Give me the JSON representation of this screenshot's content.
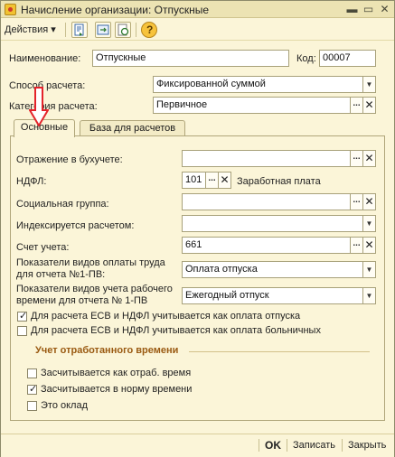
{
  "window": {
    "title": "Начисление организации: Отпускные"
  },
  "toolbar": {
    "actions_label": "Действия",
    "actions_arrow": "▾",
    "help_glyph": "?"
  },
  "form": {
    "name": {
      "label": "Наименование:",
      "value": "Отпускные"
    },
    "code": {
      "label": "Код:",
      "value": "00007"
    },
    "method": {
      "label": "Способ расчета:",
      "value": "Фиксированной суммой"
    },
    "category": {
      "label": "Категория расчета:",
      "value": "Первичное"
    }
  },
  "tabs": [
    {
      "label": "Основные"
    },
    {
      "label": "База для расчетов"
    }
  ],
  "main_tab": {
    "accounting": {
      "label": "Отражение в бухучете:",
      "value": ""
    },
    "ndfl": {
      "label": "НДФЛ:",
      "value": "101",
      "description": "Заработная плата"
    },
    "social_group": {
      "label": "Социальная группа:",
      "value": ""
    },
    "indexed": {
      "label": "Индексируется расчетом:",
      "value": ""
    },
    "account": {
      "label": "Счет учета:",
      "value": "661"
    },
    "labor_payment": {
      "label_line1": "Показатели видов оплаты труда",
      "label_line2": "для отчета №1-ПВ:",
      "value": "Оплата отпуска"
    },
    "work_time": {
      "label_line1": "Показатели видов учета рабочего",
      "label_line2": "времени для отчета № 1-ПВ",
      "value": "Ежегодный отпуск"
    },
    "checkboxes": [
      {
        "label": "Для расчета ЕСВ и НДФЛ учитывается как оплата отпуска",
        "checked": true
      },
      {
        "label": "Для расчета ЕСВ и НДФЛ учитывается как оплата больничных",
        "checked": false
      }
    ],
    "worked_time": {
      "title": "Учет отработанного времени",
      "items": [
        {
          "label": "Засчитывается как отраб. время",
          "checked": false
        },
        {
          "label": "Засчитывается в норму времени",
          "checked": true
        },
        {
          "label": "Это оклад",
          "checked": false
        }
      ]
    }
  },
  "footer": {
    "ok": "OK",
    "save": "Записать",
    "close": "Закрыть"
  },
  "icons": {
    "check_glyph": "✓",
    "clear_glyph": "✕",
    "dots_glyph": "...",
    "dropdown_glyph": "▼"
  },
  "colors": {
    "annotation_arrow": "#e4232b",
    "section_title": "#9a5a12"
  }
}
